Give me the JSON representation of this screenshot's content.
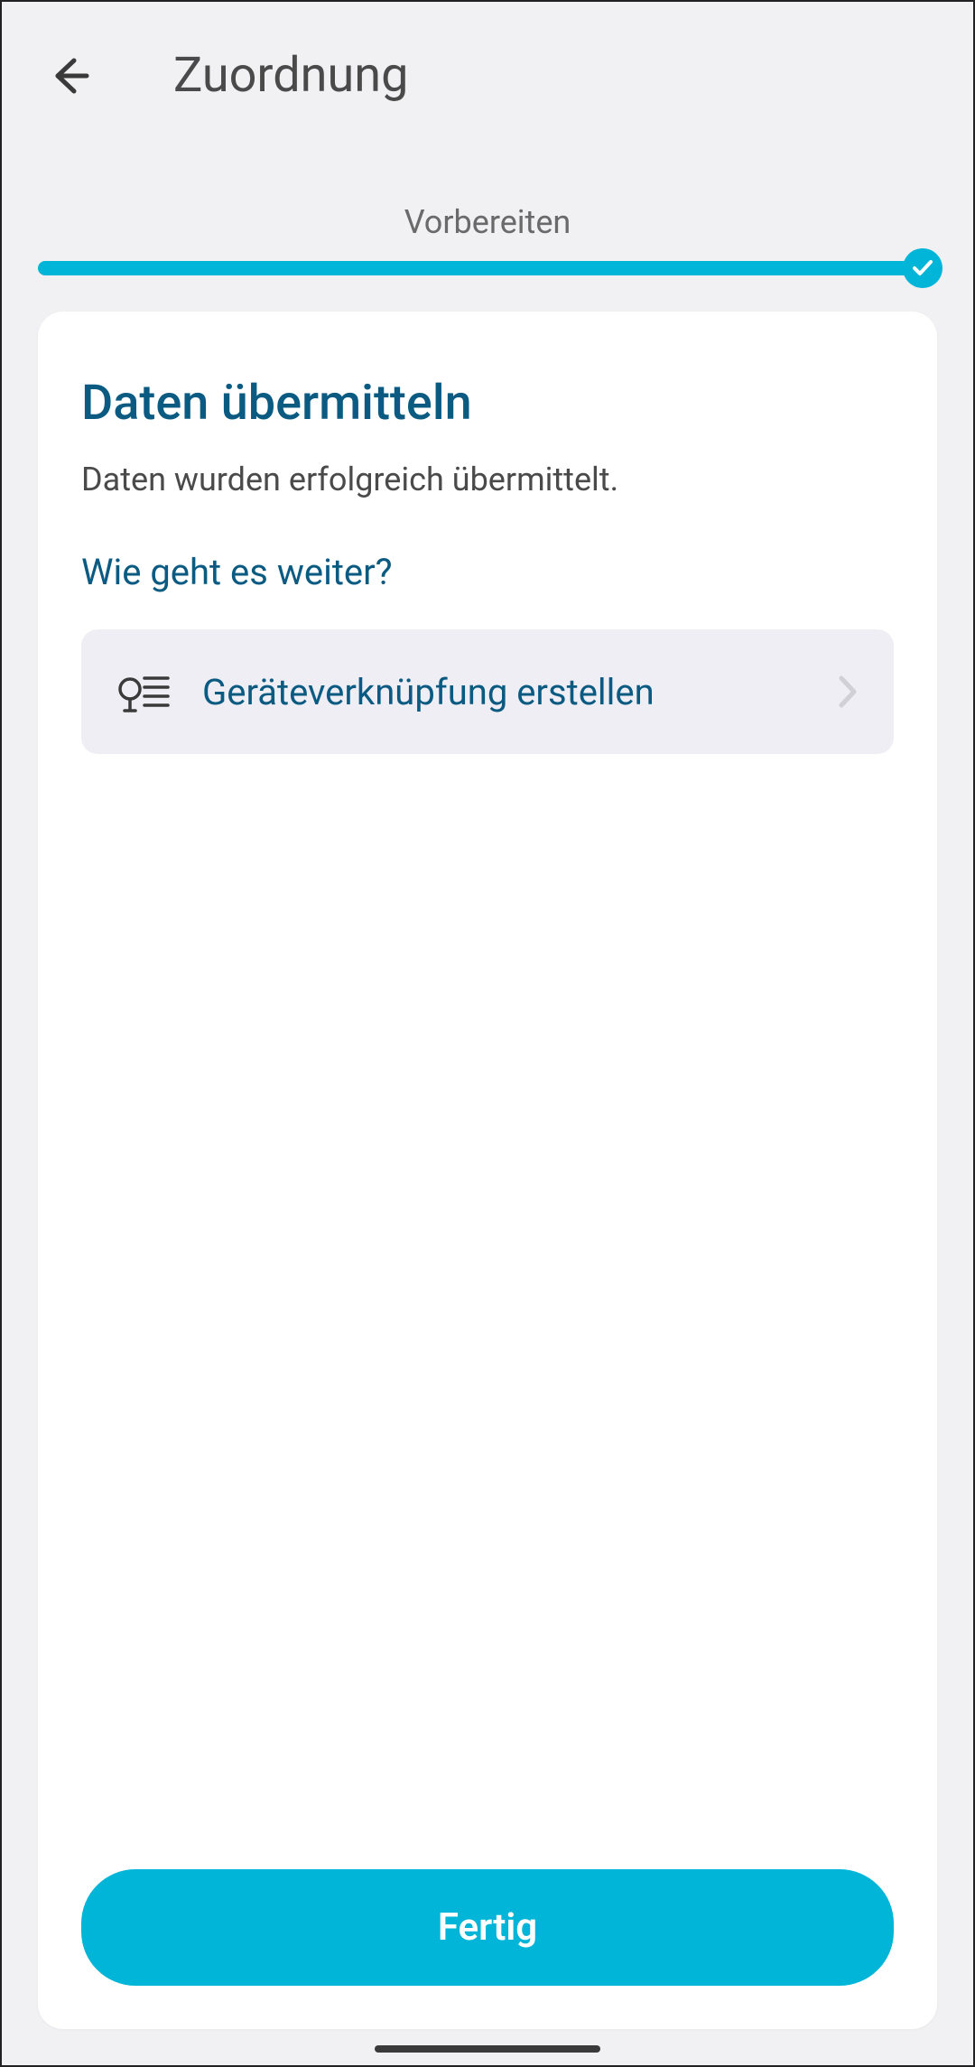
{
  "header": {
    "title": "Zuordnung"
  },
  "progress": {
    "stage_label": "Vorbereiten",
    "completed": true,
    "accent": "#00b5d8"
  },
  "card": {
    "heading": "Daten übermitteln",
    "subtext": "Daten wurden erfolgreich übermittelt.",
    "question": "Wie geht es weiter?",
    "action_label": "Geräteverknüpfung erstellen"
  },
  "footer": {
    "done_label": "Fertig"
  }
}
